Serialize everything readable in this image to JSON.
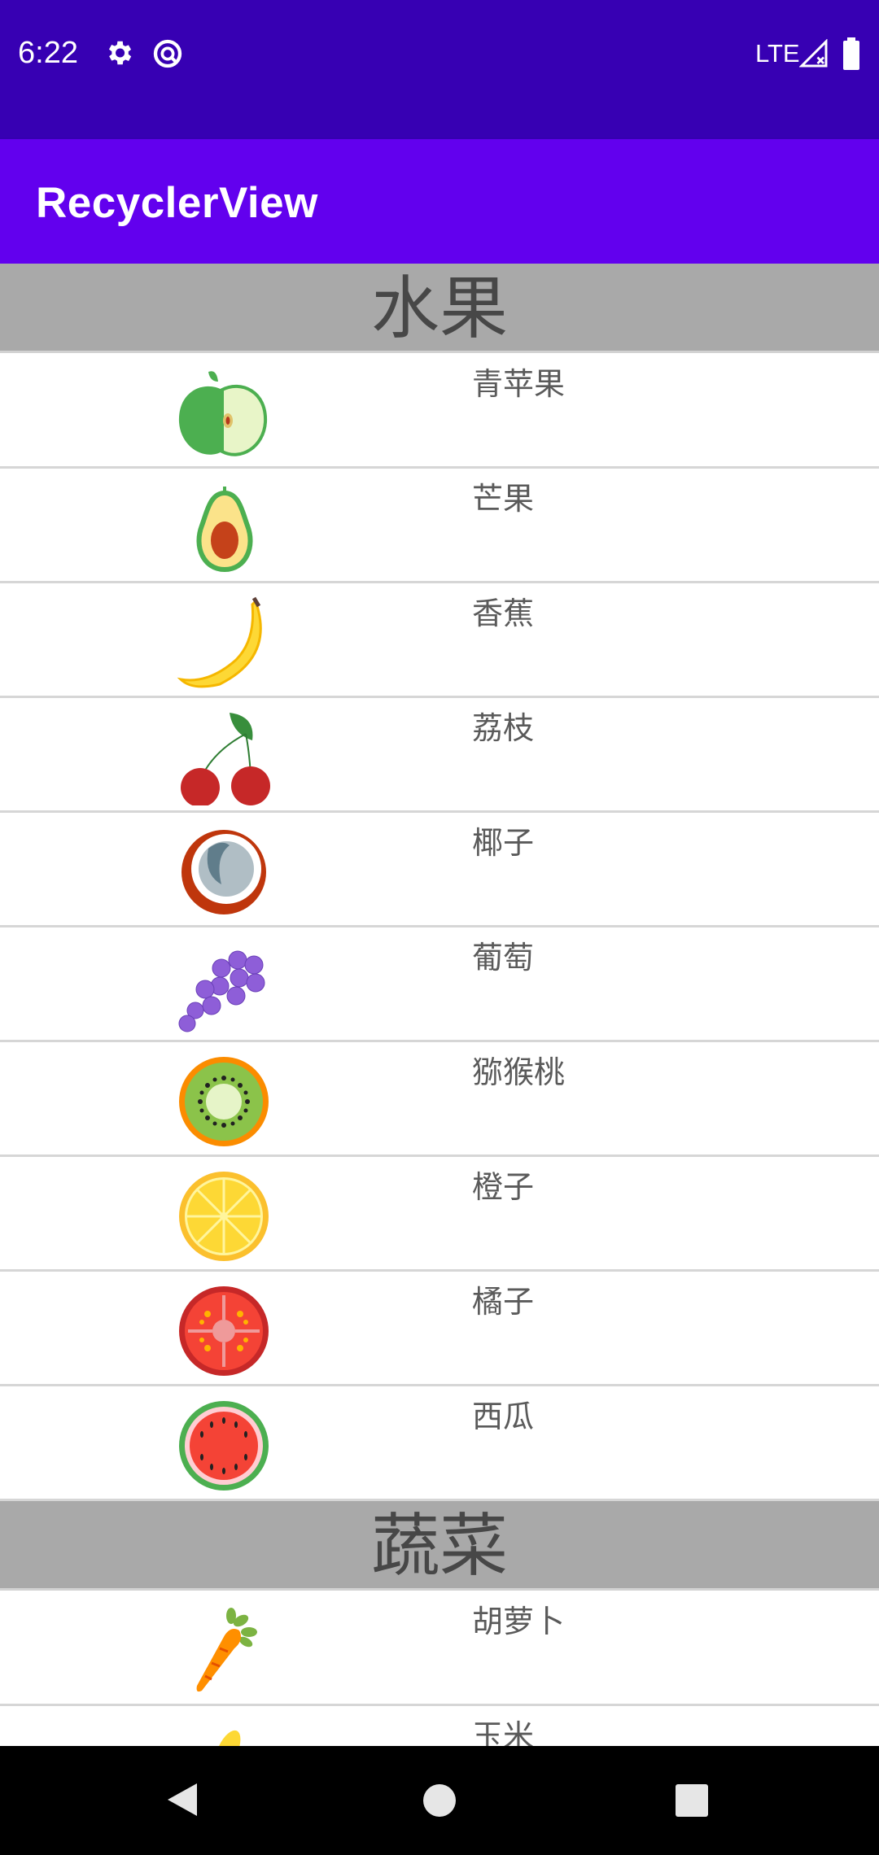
{
  "status_bar": {
    "time": "6:22",
    "network": "LTE",
    "icons": [
      "settings-icon",
      "no-disturb-icon",
      "signal-icon",
      "battery-icon"
    ]
  },
  "app_bar": {
    "title": "RecyclerView"
  },
  "sections": [
    {
      "title": "水果",
      "items": [
        {
          "label": "青苹果",
          "icon": "green-apple-icon"
        },
        {
          "label": "芒果",
          "icon": "mango-icon"
        },
        {
          "label": "香蕉",
          "icon": "banana-icon"
        },
        {
          "label": "荔枝",
          "icon": "lychee-icon"
        },
        {
          "label": "椰子",
          "icon": "coconut-icon"
        },
        {
          "label": "葡萄",
          "icon": "grape-icon"
        },
        {
          "label": "猕猴桃",
          "icon": "kiwi-icon"
        },
        {
          "label": "橙子",
          "icon": "orange-icon"
        },
        {
          "label": "橘子",
          "icon": "tangerine-icon"
        },
        {
          "label": "西瓜",
          "icon": "watermelon-icon"
        }
      ]
    },
    {
      "title": "蔬菜",
      "items": [
        {
          "label": "胡萝卜",
          "icon": "carrot-icon"
        },
        {
          "label": "玉米",
          "icon": "corn-icon"
        }
      ]
    }
  ],
  "nav_bar": {
    "buttons": [
      "back-icon",
      "home-icon",
      "recents-icon"
    ]
  },
  "colors": {
    "status_bar": "#3700b3",
    "app_bar": "#6200ee",
    "section_header": "#a9a9a9"
  }
}
